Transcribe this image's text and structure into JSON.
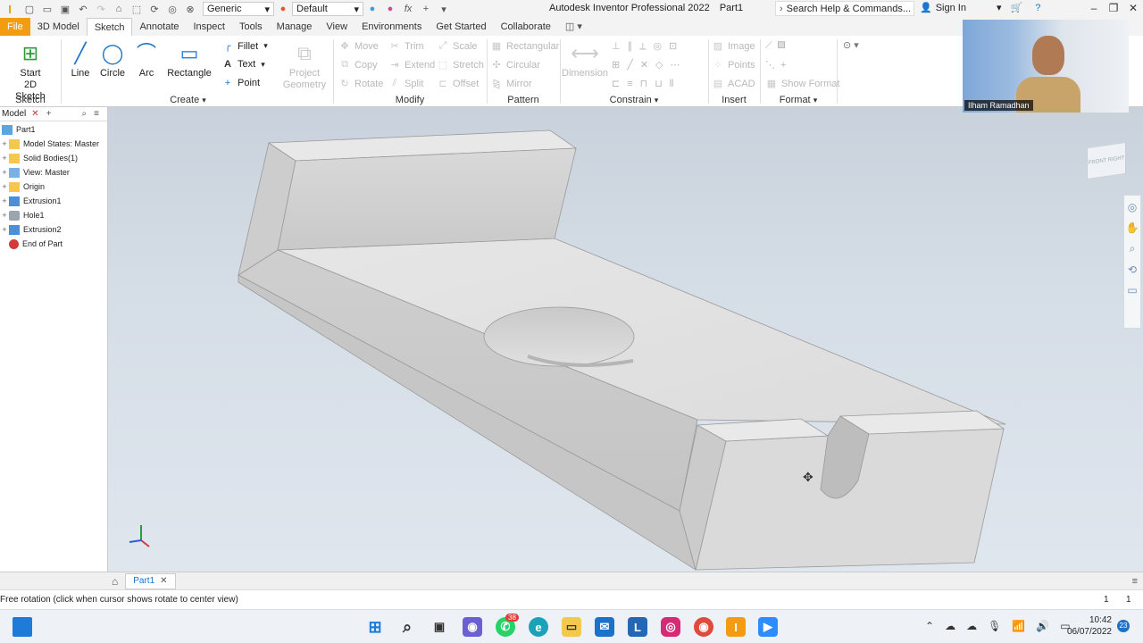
{
  "titlebar": {
    "app_title": "Autodesk Inventor Professional 2022",
    "document": "Part1",
    "material": "Generic",
    "appearance": "Default",
    "search_placeholder": "Search Help & Commands...",
    "signin": "Sign In"
  },
  "tabs": [
    "File",
    "3D Model",
    "Sketch",
    "Annotate",
    "Inspect",
    "Tools",
    "Manage",
    "View",
    "Environments",
    "Get Started",
    "Collaborate"
  ],
  "ribbon": {
    "sketch_group": {
      "label": "Sketch",
      "start_btn": "Start",
      "start_btn2": "2D Sketch"
    },
    "create_group": {
      "label": "Create",
      "line": "Line",
      "circle": "Circle",
      "arc": "Arc",
      "rectangle": "Rectangle",
      "fillet": "Fillet",
      "text": "Text",
      "point": "Point"
    },
    "project_geometry": {
      "line1": "Project",
      "line2": "Geometry"
    },
    "modify_group": {
      "label": "Modify",
      "move": "Move",
      "trim": "Trim",
      "scale": "Scale",
      "copy": "Copy",
      "extend": "Extend",
      "stretch": "Stretch",
      "rotate": "Rotate",
      "split": "Split",
      "offset": "Offset"
    },
    "pattern_group": {
      "label": "Pattern",
      "rectangular": "Rectangular",
      "circular": "Circular",
      "mirror": "Mirror"
    },
    "constrain_group": {
      "label": "Constrain",
      "dimension": "Dimension"
    },
    "insert_group": {
      "label": "Insert",
      "image": "Image",
      "points": "Points",
      "acad": "ACAD"
    },
    "format_group": {
      "label": "Format",
      "show_format": "Show Format"
    }
  },
  "browser": {
    "tab": "Model",
    "items": [
      {
        "label": "Part1",
        "icon": "part-icon",
        "level": 0
      },
      {
        "label": "Model States: Master",
        "icon": "folder-icon",
        "level": 1
      },
      {
        "label": "Solid Bodies(1)",
        "icon": "folder-icon",
        "level": 1
      },
      {
        "label": "View: Master",
        "icon": "view-icon",
        "level": 1
      },
      {
        "label": "Origin",
        "icon": "folder-icon",
        "level": 1
      },
      {
        "label": "Extrusion1",
        "icon": "extrusion-icon",
        "level": 1
      },
      {
        "label": "Hole1",
        "icon": "hole-icon",
        "level": 1
      },
      {
        "label": "Extrusion2",
        "icon": "extrusion-icon",
        "level": 1
      },
      {
        "label": "End of Part",
        "icon": "end-of-part-icon",
        "level": 1
      }
    ]
  },
  "viewcube_labels": {
    "front": "FRONT",
    "right": "RIGHT"
  },
  "doc_tab": "Part1",
  "status": {
    "message": "Free rotation (click when cursor shows rotate to center view)",
    "num1": "1",
    "num2": "1"
  },
  "webcam": {
    "name": "Ilham Ramadhan"
  },
  "taskbar": {
    "time": "10:42",
    "date": "06/07/2022",
    "badge": "38",
    "notif": "23"
  },
  "colors": {
    "file_tab": "#f39c12",
    "accent": "#1a73c9"
  }
}
